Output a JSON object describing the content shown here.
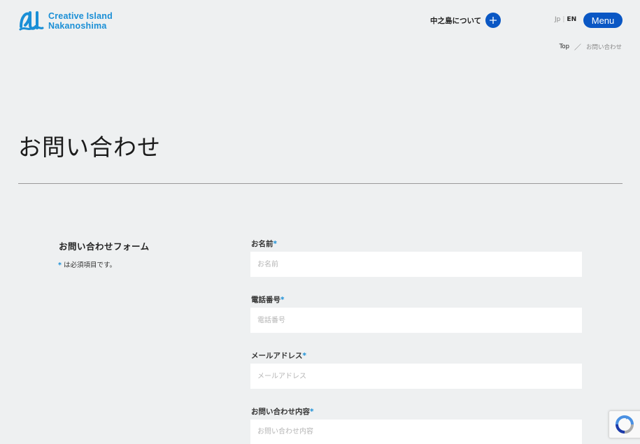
{
  "header": {
    "logo_line1": "Creative Island",
    "logo_line2": "Nakanoshima",
    "about_label": "中之島について",
    "lang_jp": "Jp",
    "lang_sep": "|",
    "lang_en": "EN",
    "menu_label": "Menu"
  },
  "breadcrumb": {
    "top": "Top",
    "separator": "／",
    "current": "お問い合わせ"
  },
  "page": {
    "title": "お問い合わせ"
  },
  "form": {
    "heading": "お問い合わせフォーム",
    "required_mark": "*",
    "required_note": " は必須項目です。",
    "fields": [
      {
        "label": "お名前",
        "placeholder": "お名前"
      },
      {
        "label": "電話番号",
        "placeholder": "電話番号"
      },
      {
        "label": "メールアドレス",
        "placeholder": "メールアドレス"
      },
      {
        "label": "お問い合わせ内容",
        "placeholder": "お問い合わせ内容"
      }
    ]
  },
  "colors": {
    "brand_blue": "#0a57c4",
    "logo_blue": "#1a8fd6",
    "background": "#eef0f1"
  },
  "icons": {
    "logo": "creative-island-logo-icon",
    "plus": "plus-icon",
    "recaptcha": "recaptcha-icon"
  }
}
